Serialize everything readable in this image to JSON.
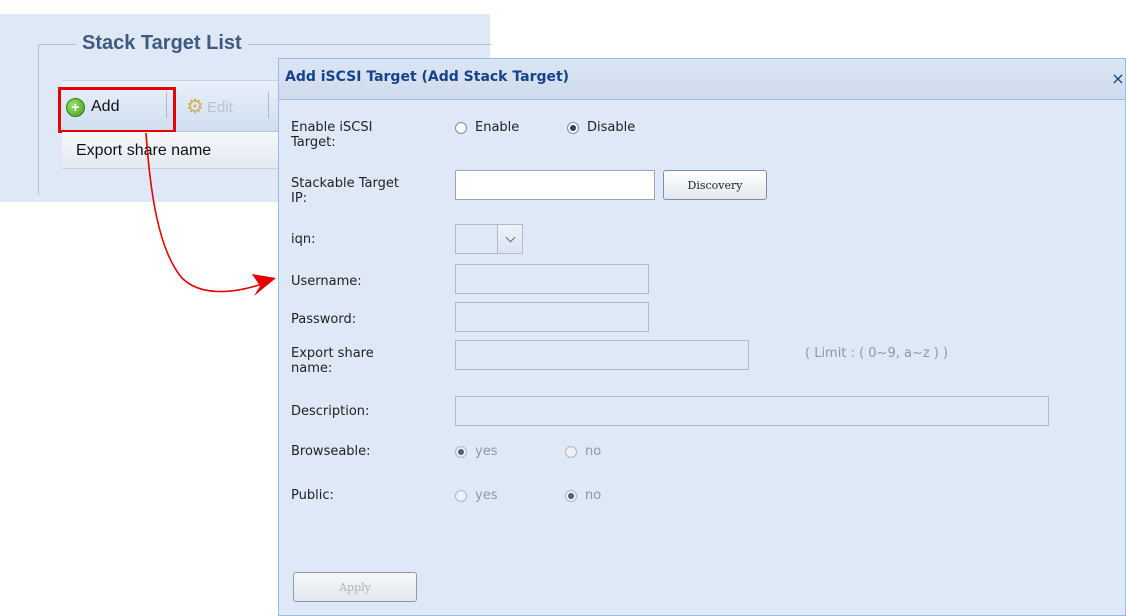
{
  "background": {
    "panel_title": "Stack Target List",
    "toolbar": {
      "add_label": "Add",
      "edit_label": "Edit"
    },
    "column_header": "Export share name"
  },
  "dialog": {
    "title": "Add iSCSI Target (Add Stack Target)",
    "close_glyph": "×",
    "enable_target": {
      "label_line1": "Enable iSCSI",
      "label_line2": "Target:",
      "options": [
        "Enable",
        "Disable"
      ],
      "selected": "Disable"
    },
    "stackable_ip": {
      "label_line1": "Stackable Target",
      "label_line2": "IP:",
      "value": "",
      "discovery_label": "Discovery"
    },
    "iqn": {
      "label": "iqn:",
      "value": ""
    },
    "username": {
      "label": "Username:",
      "value": ""
    },
    "password": {
      "label": "Password:",
      "value": ""
    },
    "export_share": {
      "label_line1": "Export share",
      "label_line2": "name:",
      "value": "",
      "hint": "( Limit : ( 0~9, a~z ) )"
    },
    "description": {
      "label": "Description:",
      "value": ""
    },
    "browseable": {
      "label": "Browseable:",
      "options": [
        "yes",
        "no"
      ],
      "selected": "yes"
    },
    "public": {
      "label": "Public:",
      "options": [
        "yes",
        "no"
      ],
      "selected": "no"
    },
    "apply_label": "Apply"
  },
  "colors": {
    "highlight_red": "#e60000",
    "panel_blue": "#dfe8f6",
    "title_blue": "#15428b"
  }
}
